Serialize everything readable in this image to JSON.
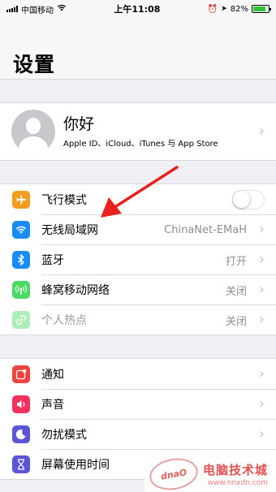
{
  "status_bar": {
    "carrier": "中国移动",
    "time": "上午11:08",
    "battery_percent": "82%",
    "battery_level": 0.82
  },
  "header": {
    "title": "设置"
  },
  "profile": {
    "name": "你好",
    "subtitle": "Apple ID、iCloud、iTunes 与 App Store"
  },
  "group_network": [
    {
      "label": "飞行模式",
      "icon": "airplane-icon",
      "color": "#f59b20",
      "toggle": false
    },
    {
      "label": "无线局域网",
      "icon": "wifi-icon",
      "color": "#1a8cf5",
      "value": "ChinaNet-EMaH"
    },
    {
      "label": "蓝牙",
      "icon": "bluetooth-icon",
      "color": "#1a8cf5",
      "value": "打开"
    },
    {
      "label": "蜂窝移动网络",
      "icon": "cellular-icon",
      "color": "#4cd964",
      "value": "关闭"
    },
    {
      "label": "个人热点",
      "icon": "hotspot-icon",
      "color": "#4cd964",
      "value": "关闭",
      "disabled": true
    }
  ],
  "group_notify": [
    {
      "label": "通知",
      "icon": "notifications-icon",
      "color": "#f0423e"
    },
    {
      "label": "声音",
      "icon": "sound-icon",
      "color": "#f0325c"
    },
    {
      "label": "勿扰模式",
      "icon": "moon-icon",
      "color": "#5a56d6"
    },
    {
      "label": "屏幕使用时间",
      "icon": "hourglass-icon",
      "color": "#5a56d6"
    }
  ],
  "watermark": {
    "logo": "dnaO",
    "title": "电脑技术城",
    "url": "www.nnxdn.com"
  },
  "annotation": {
    "arrow_color": "#e8201e"
  }
}
